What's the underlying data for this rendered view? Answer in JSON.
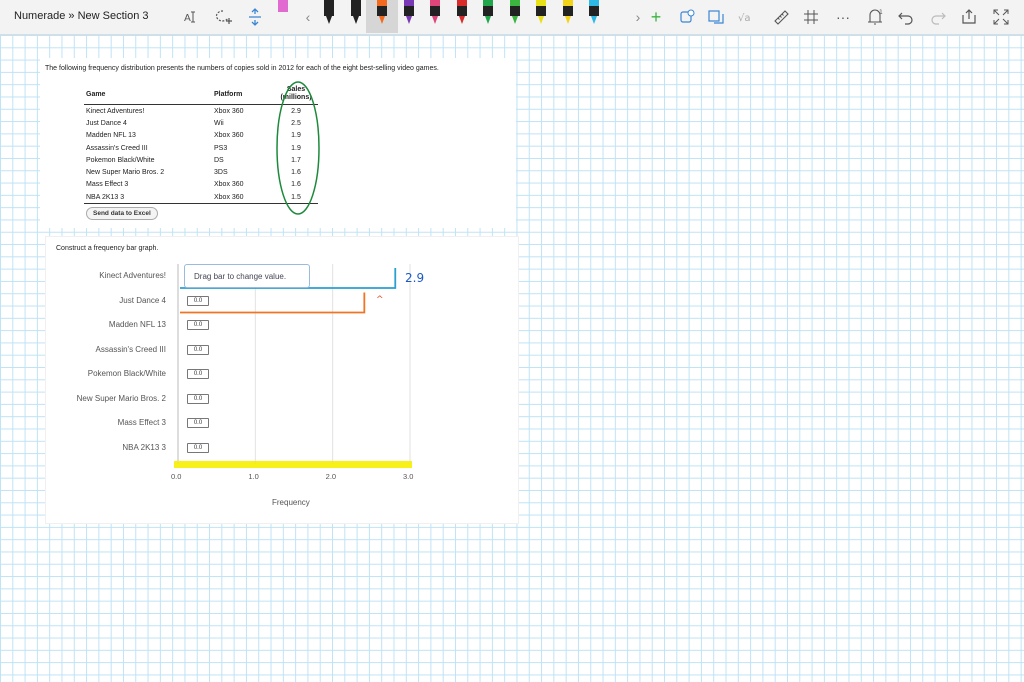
{
  "breadcrumb": "Numerade » New Section 3",
  "toolbar": {
    "icons": [
      "select-text-icon",
      "lasso-add-icon",
      "insert-space-icon",
      "more-right-icon",
      "add-pen-icon",
      "lasso-icon",
      "convert-icon",
      "math-icon",
      "ruler-icon",
      "grid-icon",
      "more-icon",
      "touch-writing-icon",
      "undo-icon",
      "redo-icon",
      "share-icon",
      "fullscreen-icon"
    ],
    "pens": [
      {
        "color": "#e06ad0"
      },
      {
        "color": "#222222"
      },
      {
        "color": "#222222"
      },
      {
        "color": "#f36a1e"
      },
      {
        "color": "#7b3ab5"
      },
      {
        "color": "#e0457a"
      },
      {
        "color": "#d82b2b"
      },
      {
        "color": "#22a64b"
      },
      {
        "color": "#3cb540"
      },
      {
        "color": "#e8e019"
      },
      {
        "color": "#f3d319"
      },
      {
        "color": "#2db8e6"
      }
    ],
    "more_left": "‹",
    "more_right": "›",
    "add_pen": "+",
    "more_dots": "···",
    "notification_count": "1"
  },
  "problem": {
    "intro": "The following frequency distribution presents the numbers of copies sold in 2012  for each of the eight best-selling video games.",
    "columns": [
      "Game",
      "Platform",
      "Sales (millions)"
    ],
    "rows": [
      [
        "Kinect Adventures!",
        "Xbox 360",
        "2.9"
      ],
      [
        "Just Dance 4",
        "Wii",
        "2.5"
      ],
      [
        "Madden NFL 13",
        "Xbox 360",
        "1.9"
      ],
      [
        "Assassin's Creed III",
        "PS3",
        "1.9"
      ],
      [
        "Pokemon Black/White",
        "DS",
        "1.7"
      ],
      [
        "New Super Mario Bros. 2",
        "3DS",
        "1.6"
      ],
      [
        "Mass Effect 3",
        "Xbox 360",
        "1.6"
      ],
      [
        "NBA 2K13 3",
        "Xbox 360",
        "1.5"
      ]
    ],
    "excel_button": "Send data to Excel",
    "construct_label": "Construct a frequency bar graph.",
    "tooltip": "Drag bar to change value.",
    "annotation_value": "2.9",
    "annotation_mark": "^"
  },
  "chart_data": {
    "type": "bar",
    "orientation": "horizontal",
    "categories": [
      "Kinect Adventures!",
      "Just Dance 4",
      "Madden NFL 13",
      "Assassin's Creed III",
      "Pokemon Black/White",
      "New Super Mario Bros. 2",
      "Mass Effect 3",
      "NBA 2K13 3"
    ],
    "values": [
      0.0,
      0.0,
      0.0,
      0.0,
      0.0,
      0.0,
      0.0,
      0.0
    ],
    "value_labels": [
      "",
      "0.0",
      "0.0",
      "0.0",
      "0.0",
      "0.0",
      "0.0",
      "0.0"
    ],
    "xticks": [
      "0.0",
      "1.0",
      "2.0",
      "3.0"
    ],
    "xlim": [
      0,
      3
    ],
    "xlabel": "Frequency",
    "grid": true,
    "ink_bars": [
      {
        "category": "Kinect Adventures!",
        "value": 2.9,
        "color": "#2a9fd0"
      },
      {
        "category": "Just Dance 4",
        "value": 2.5,
        "color": "#f07522"
      }
    ],
    "highlight_color": "#f6f000"
  }
}
